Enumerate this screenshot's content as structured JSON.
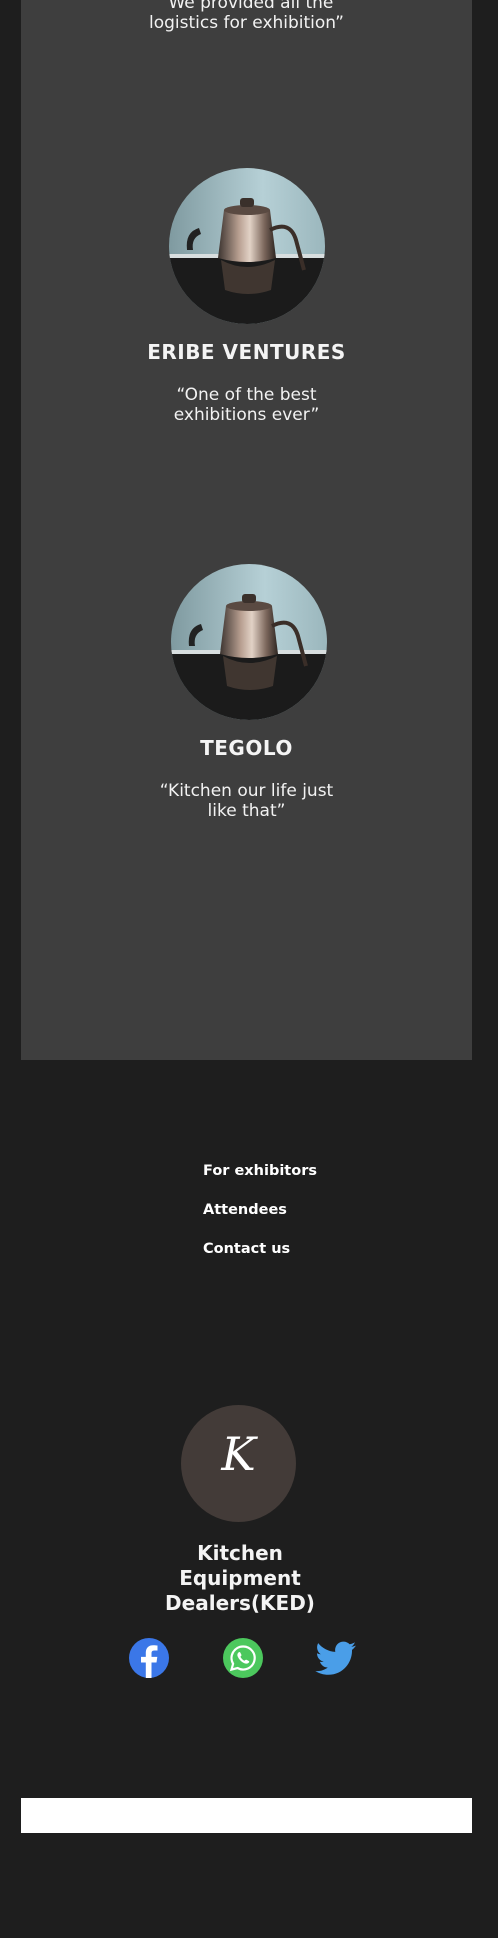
{
  "testimonials": [
    {
      "company": "",
      "quote_lines": [
        "“We provided all the",
        "logistics for exhibition”"
      ]
    },
    {
      "company": "ERIBE VENTURES",
      "quote_lines": [
        "“One of the best",
        "exhibitions ever”"
      ]
    },
    {
      "company": "TEGOLO",
      "quote_lines": [
        "“Kitchen our life just",
        "like that”"
      ]
    }
  ],
  "footer": {
    "links": [
      "For exhibitors",
      "Attendees",
      "Contact us"
    ],
    "logo_letter": "K",
    "brand_lines": [
      "Kitchen",
      "Equipment",
      "Dealers(KED)"
    ],
    "social": [
      {
        "icon": "facebook-icon",
        "color": "#3b77e8"
      },
      {
        "icon": "whatsapp-icon",
        "color": "#4cc85d"
      },
      {
        "icon": "twitter-icon",
        "color": "#4a9ee8"
      }
    ]
  },
  "colors": {
    "page_background": "#1e1e1e",
    "panel_background": "#3e3e3e",
    "logo_circle": "#433b38"
  }
}
